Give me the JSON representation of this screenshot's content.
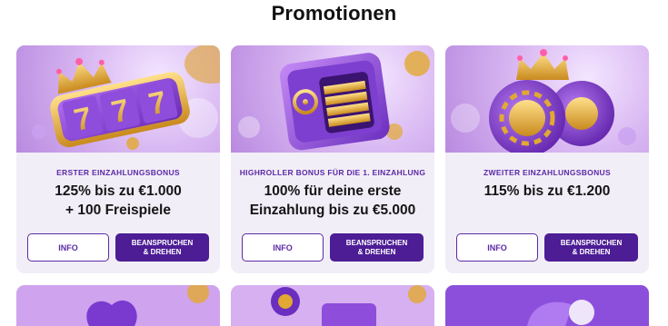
{
  "page": {
    "title": "Promotionen"
  },
  "promotions": [
    {
      "label": "ERSTER EINZAHLUNGSBONUS",
      "headline_line1": "125% bis zu €1.000",
      "headline_line2": "+ 100 Freispiele",
      "info_label": "INFO",
      "claim_line1": "BEANSPRUCHEN",
      "claim_line2": "& DREHEN",
      "slot_digit": "7"
    },
    {
      "label": "HIGHROLLER BONUS FÜR DIE 1. EINZAHLUNG",
      "headline_line1": "100% für deine erste",
      "headline_line2": "Einzahlung bis zu €5.000",
      "info_label": "INFO",
      "claim_line1": "BEANSPRUCHEN",
      "claim_line2": "& DREHEN"
    },
    {
      "label": "ZWEITER EINZAHLUNGSBONUS",
      "headline_line1": "115% bis zu €1.200",
      "headline_line2": "",
      "info_label": "INFO",
      "claim_line1": "BEANSPRUCHEN",
      "claim_line2": "& DREHEN"
    }
  ],
  "colors": {
    "accent": "#5b2aa5",
    "button_dark": "#4c1d95",
    "card_bg": "#f2eef8",
    "gold": "#e2a932"
  }
}
